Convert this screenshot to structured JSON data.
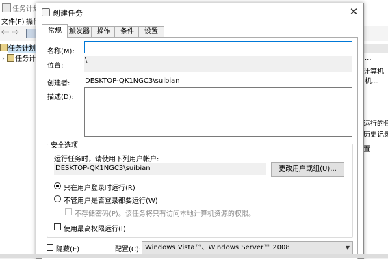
{
  "background": {
    "window_title": "任务计划",
    "menu": [
      "文件(F)",
      "操作(A)"
    ],
    "tree": [
      "任务计划",
      "任务计"
    ],
    "right_panel": [
      "计算机",
      "运行的任",
      "历史记录",
      "置"
    ],
    "right_extra": [
      "...",
      "机..."
    ]
  },
  "dialog": {
    "title": "创建任务",
    "close": "✕",
    "tabs": [
      "常规",
      "触发器",
      "操作",
      "条件",
      "设置"
    ],
    "name_label": "名称(M):",
    "name_value": "",
    "location_label": "位置:",
    "location_value": "\\",
    "author_label": "创建者:",
    "author_value": "DESKTOP-QK1NGC3\\suibian",
    "description_label": "描述(D):",
    "description_value": "",
    "security": {
      "title": "安全选项",
      "run_as_prompt": "运行任务时，请使用下列用户帐户:",
      "run_as_user": "DESKTOP-QK1NGC3\\suibian",
      "change_user_button": "更改用户或组(U)...",
      "radio_logged_on": "只在用户登录时运行(R)",
      "radio_whether": "不管用户是否登录都要运行(W)",
      "no_store_password": "不存储密码(P)。该任务将只有访问本地计算机资源的权限。",
      "highest_privileges": "使用最高权限运行(I)"
    },
    "hidden_label": "隐藏(E)",
    "configure_label": "配置(C):",
    "configure_value": "Windows Vista™、Windows Server™ 2008"
  }
}
